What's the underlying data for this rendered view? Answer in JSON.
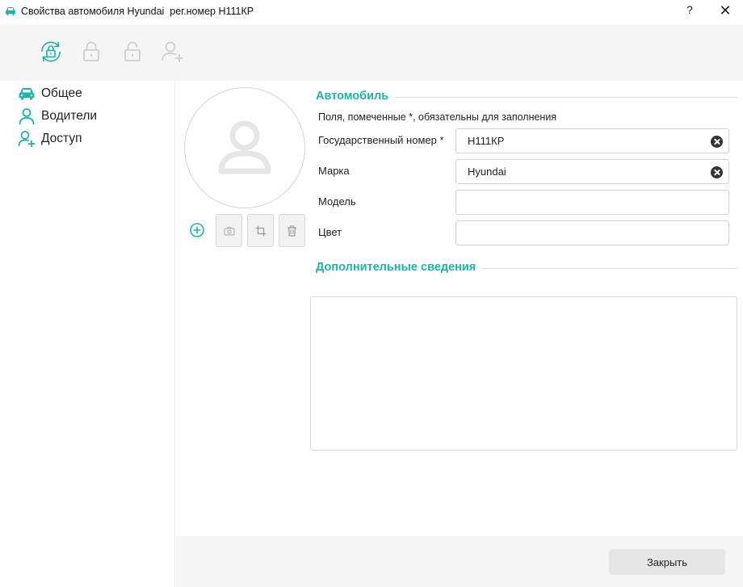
{
  "window": {
    "title": "Свойства автомобиля Hyundai  рег.номер Н111КР",
    "help_label": "?",
    "close_label": "✕"
  },
  "toolbar": {
    "icons": [
      "sync-lock-icon",
      "lock-icon",
      "unlock-icon",
      "add-user-icon"
    ]
  },
  "sidebar": {
    "items": [
      {
        "label": "Общее",
        "icon": "car-icon"
      },
      {
        "label": "Водители",
        "icon": "user-icon"
      },
      {
        "label": "Доступ",
        "icon": "user-access-icon"
      }
    ]
  },
  "photo": {
    "buttons": [
      "camera-icon",
      "crop-icon",
      "trash-icon"
    ]
  },
  "car_section": {
    "title": "Автомобиль",
    "hint": "Поля, помеченные *, обязательны для заполнения",
    "fields": [
      {
        "label": "Государственный номер  *",
        "value": "Н111КР"
      },
      {
        "label": "Марка",
        "value": "Hyundai"
      },
      {
        "label": "Модель",
        "value": ""
      },
      {
        "label": "Цвет",
        "value": ""
      }
    ]
  },
  "extra_section": {
    "title": "Дополнительные сведения",
    "notes": ""
  },
  "footer": {
    "close_button": "Закрыть"
  },
  "colors": {
    "accent": "#1bb5a6",
    "toolbar_bg": "#f5f5f5",
    "disabled_icon": "#cfcfcf"
  }
}
